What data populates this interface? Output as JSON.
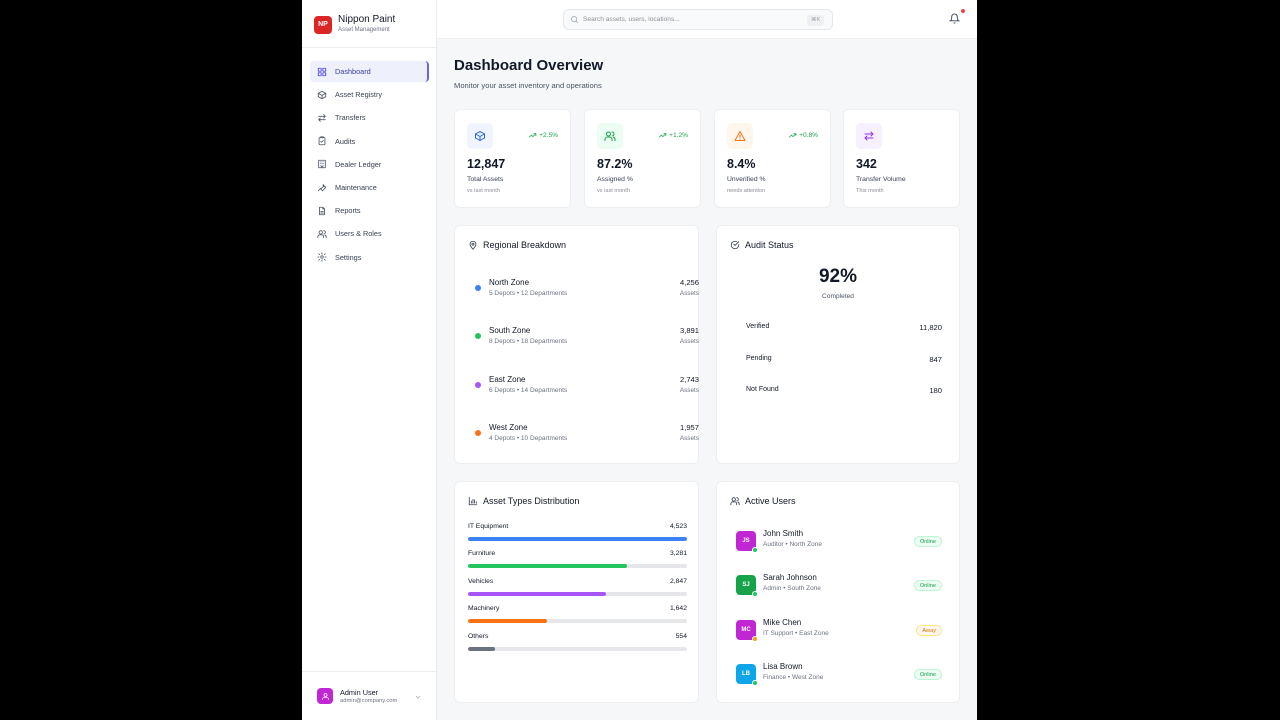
{
  "brand": {
    "logo": "NP",
    "name": "Nippon Paint",
    "subtitle": "Asset Management"
  },
  "nav": {
    "items": [
      {
        "label": "Dashboard",
        "icon": "grid-icon",
        "active": true
      },
      {
        "label": "Asset Registry",
        "icon": "box-icon"
      },
      {
        "label": "Transfers",
        "icon": "arrows-icon"
      },
      {
        "label": "Audits",
        "icon": "clipboard-check-icon"
      },
      {
        "label": "Dealer Ledger",
        "icon": "building-icon"
      },
      {
        "label": "Maintenance",
        "icon": "wrench-icon"
      },
      {
        "label": "Reports",
        "icon": "file-icon"
      },
      {
        "label": "Users & Roles",
        "icon": "users-icon"
      },
      {
        "label": "Settings",
        "icon": "gear-icon"
      }
    ]
  },
  "user": {
    "name": "Admin User",
    "email": "admin@company.com"
  },
  "topbar": {
    "search_placeholder": "Search assets, users, locations...",
    "shortcut": "⌘K"
  },
  "page": {
    "title": "Dashboard Overview",
    "subtitle": "Monitor your asset inventory and operations"
  },
  "stats": [
    {
      "value": "12,847",
      "label": "Total Assets",
      "note": "vs last month",
      "trend": "+2.5%",
      "icon": "cube-icon",
      "color": "#2563eb",
      "bg": "#eff4ff"
    },
    {
      "value": "87.2%",
      "label": "Assigned %",
      "note": "vs last month",
      "trend": "+1.2%",
      "icon": "users-icon",
      "color": "#16a34a",
      "bg": "#ecfdf3"
    },
    {
      "value": "8.4%",
      "label": "Unverified %",
      "note": "needs attention",
      "trend": "+0.8%",
      "icon": "warning-icon",
      "color": "#f97316",
      "bg": "#fff7ed"
    },
    {
      "value": "342",
      "label": "Transfer Volume",
      "note": "This month",
      "trend": "",
      "icon": "transfer-icon",
      "color": "#9333ea",
      "bg": "#f6f0ff"
    }
  ],
  "regional": {
    "title": "Regional Breakdown",
    "zones": [
      {
        "name": "North Zone",
        "detail": "5 Depots • 12 Departments",
        "value": "4,256",
        "unit": "Assets",
        "color": "#3b82f6"
      },
      {
        "name": "South Zone",
        "detail": "8 Depots • 18 Departments",
        "value": "3,891",
        "unit": "Assets",
        "color": "#22c55e"
      },
      {
        "name": "East Zone",
        "detail": "6 Depots • 14 Departments",
        "value": "2,743",
        "unit": "Assets",
        "color": "#a855f7"
      },
      {
        "name": "West Zone",
        "detail": "4 Depots • 10 Departments",
        "value": "1,957",
        "unit": "Assets",
        "color": "#f97316"
      }
    ]
  },
  "audit": {
    "title": "Audit Status",
    "percent": "92%",
    "percent_label": "Completed",
    "rows": [
      {
        "label": "Verified",
        "value": "11,820"
      },
      {
        "label": "Pending",
        "value": "847"
      },
      {
        "label": "Not Found",
        "value": "180"
      }
    ]
  },
  "asset_types": {
    "title": "Asset Types Distribution",
    "items": [
      {
        "label": "IT Equipment",
        "value": "4,523",
        "fraction": 1.0,
        "color": "#3b82f6"
      },
      {
        "label": "Furniture",
        "value": "3,281",
        "fraction": 0.725,
        "color": "#22c55e"
      },
      {
        "label": "Vehicles",
        "value": "2,847",
        "fraction": 0.63,
        "color": "#a855f7"
      },
      {
        "label": "Machinery",
        "value": "1,642",
        "fraction": 0.363,
        "color": "#f97316"
      },
      {
        "label": "Others",
        "value": "554",
        "fraction": 0.122,
        "color": "#6b7280"
      }
    ]
  },
  "active_users": {
    "title": "Active Users",
    "users": [
      {
        "initials": "JS",
        "name": "John Smith",
        "role": "Auditor • North Zone",
        "status": "Online",
        "color": "#c026d3"
      },
      {
        "initials": "SJ",
        "name": "Sarah Johnson",
        "role": "Admin • South Zone",
        "status": "Online",
        "color": "#16a34a"
      },
      {
        "initials": "MC",
        "name": "Mike Chen",
        "role": "IT Support • East Zone",
        "status": "Away",
        "color": "#c026d3"
      },
      {
        "initials": "LB",
        "name": "Lisa Brown",
        "role": "Finance • West Zone",
        "status": "Online",
        "color": "#0ea5e9"
      }
    ]
  }
}
